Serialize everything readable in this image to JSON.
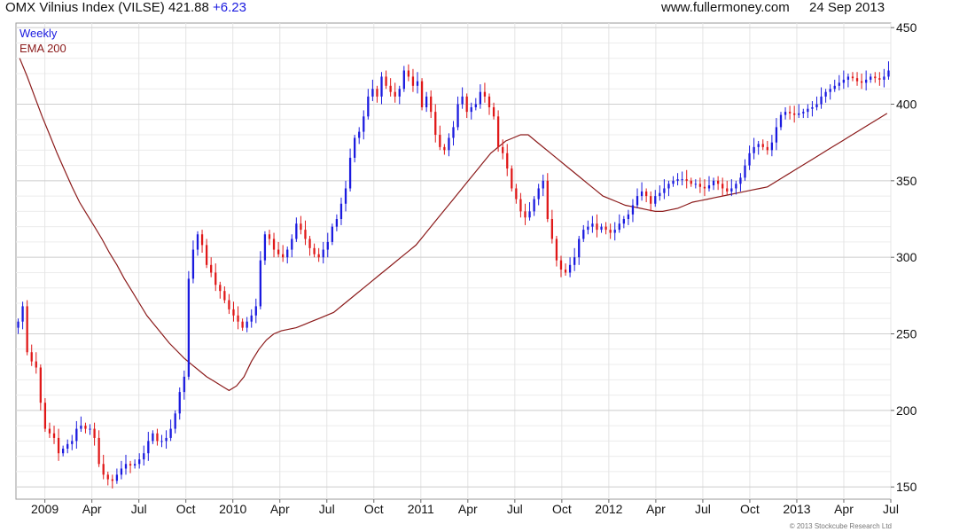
{
  "header": {
    "title": "OMX Vilnius Index (VILSE)",
    "last": "421.88",
    "change": "+6.23",
    "site": "www.fullermoney.com",
    "date": "24 Sep 2013"
  },
  "legend": {
    "period": "Weekly",
    "ema": "EMA 200",
    "period_color": "#1a1adf",
    "ema_color": "#8b1a1a"
  },
  "copyright": "© 2013 Stockcube Research Ltd",
  "chart_data": {
    "type": "candlestick",
    "title": "OMX Vilnius Index (VILSE)",
    "frequency": "weekly",
    "colors": {
      "up": "#1a1adf",
      "down": "#e01818",
      "ema": "#8b1a1a"
    },
    "ylim": [
      142,
      453
    ],
    "yticks": [
      150,
      200,
      250,
      300,
      350,
      400,
      450
    ],
    "xlim": [
      0,
      161
    ],
    "x_tick_labels": [
      {
        "week": 8,
        "label": "2009"
      },
      {
        "week": 21,
        "label": "Apr"
      },
      {
        "week": 34,
        "label": "Jul"
      },
      {
        "week": 47,
        "label": "Oct"
      },
      {
        "week": 60,
        "label": "2010"
      },
      {
        "week": 73,
        "label": "Apr"
      },
      {
        "week": 86,
        "label": "Jul"
      },
      {
        "week": 99,
        "label": "Oct"
      },
      {
        "week": 112,
        "label": "2011"
      },
      {
        "week": 125,
        "label": "Apr"
      },
      {
        "week": 138,
        "label": "Jul"
      },
      {
        "week": 151,
        "label": "Oct"
      },
      {
        "week": 164,
        "label": "2012"
      },
      {
        "week": 177,
        "label": "Apr"
      },
      {
        "week": 190,
        "label": "Jul"
      },
      {
        "week": 203,
        "label": "Oct"
      },
      {
        "week": 216,
        "label": "2013"
      },
      {
        "week": 229,
        "label": "Apr"
      },
      {
        "week": 242,
        "label": "Jul"
      }
    ],
    "close": [
      258,
      268,
      238,
      232,
      228,
      205,
      188,
      185,
      182,
      172,
      175,
      178,
      180,
      188,
      190,
      188,
      188,
      182,
      165,
      158,
      155,
      154,
      158,
      162,
      165,
      164,
      165,
      168,
      172,
      180,
      185,
      180,
      180,
      182,
      188,
      198,
      212,
      222,
      286,
      305,
      315,
      308,
      295,
      290,
      282,
      278,
      272,
      266,
      262,
      258,
      254,
      258,
      262,
      268,
      298,
      315,
      312,
      305,
      302,
      300,
      305,
      312,
      322,
      318,
      312,
      306,
      302,
      300,
      305,
      310,
      320,
      325,
      335,
      345,
      365,
      378,
      382,
      392,
      405,
      410,
      405,
      418,
      412,
      408,
      405,
      410,
      422,
      418,
      412,
      415,
      398,
      405,
      395,
      380,
      372,
      370,
      378,
      385,
      400,
      405,
      395,
      398,
      400,
      408,
      405,
      398,
      392,
      372,
      368,
      358,
      345,
      338,
      330,
      326,
      330,
      338,
      345,
      350,
      325,
      312,
      298,
      292,
      290,
      295,
      300,
      312,
      318,
      320,
      322,
      318,
      320,
      318,
      316,
      318,
      322,
      325,
      328,
      334,
      340,
      343,
      340,
      335,
      340,
      342,
      345,
      348,
      350,
      351,
      351,
      350,
      348,
      348,
      346,
      345,
      347,
      350,
      348,
      345,
      343,
      345,
      348,
      352,
      360,
      368,
      372,
      374,
      372,
      370,
      375,
      385,
      393,
      395,
      394,
      393,
      394,
      395,
      397,
      398,
      400,
      405,
      408,
      410,
      412,
      414,
      416,
      418,
      417,
      415,
      414,
      416,
      418,
      417,
      416,
      418,
      422
    ],
    "ema": [
      430,
      418,
      405,
      392,
      380,
      368,
      357,
      346,
      336,
      328,
      320,
      312,
      303,
      295,
      286,
      278,
      270,
      262,
      256,
      250,
      244,
      239,
      234,
      230,
      226,
      222,
      219,
      216,
      213,
      216,
      222,
      232,
      240,
      246,
      250,
      252,
      253,
      254,
      256,
      258,
      260,
      262,
      264,
      268,
      272,
      276,
      280,
      284,
      288,
      292,
      296,
      300,
      304,
      308,
      314,
      320,
      326,
      332,
      338,
      344,
      350,
      356,
      362,
      368,
      372,
      376,
      378,
      380,
      380,
      376,
      372,
      368,
      364,
      360,
      356,
      352,
      348,
      344,
      340,
      338,
      336,
      334,
      333,
      332,
      331,
      330,
      330,
      331,
      332,
      334,
      336,
      337,
      338,
      339,
      340,
      341,
      342,
      343,
      344,
      345,
      346,
      349,
      352,
      355,
      358,
      361,
      364,
      367,
      370,
      373,
      376,
      379,
      382,
      385,
      388,
      391,
      394
    ]
  }
}
